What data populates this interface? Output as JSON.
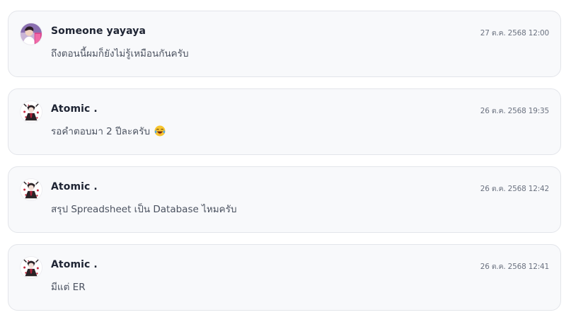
{
  "comments": [
    {
      "author": "Someone yayaya",
      "timestamp": "27 ต.ค. 2568 12:00",
      "message": "ถึงตอนนี้ผมก็ยังไม่รู้เหมือนกันครับ",
      "avatar_icon": "profile-photo-avatar"
    },
    {
      "author": "Atomic .",
      "timestamp": "26 ต.ค. 2568 19:35",
      "message": "รอคำตอบมา 2 ปีละครับ",
      "emoji": "laughing-crying-emoji",
      "avatar_icon": "anime-character-avatar"
    },
    {
      "author": "Atomic .",
      "timestamp": "26 ต.ค. 2568 12:42",
      "message": "สรุป Spreadsheet เป็น Database ไหมครับ",
      "avatar_icon": "anime-character-avatar"
    },
    {
      "author": "Atomic .",
      "timestamp": "26 ต.ค. 2568 12:41",
      "message": "มีแต่ ER",
      "avatar_icon": "anime-character-avatar"
    }
  ]
}
